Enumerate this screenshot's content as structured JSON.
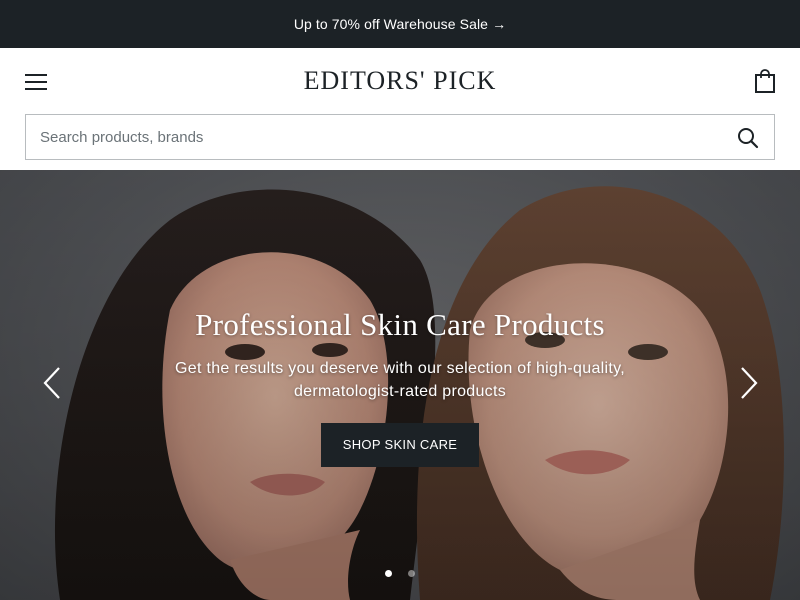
{
  "announcement": {
    "text": "Up to 70% off Warehouse Sale",
    "arrow": "→"
  },
  "header": {
    "logo": "EDITORS' PICK",
    "menu_icon": "hamburger-menu-icon",
    "cart_icon": "shopping-bag-icon"
  },
  "search": {
    "placeholder": "Search products, brands",
    "value": "",
    "icon": "search-icon"
  },
  "hero": {
    "title": "Professional Skin Care Products",
    "subtitle": "Get the results you deserve with our selection of high-quality, dermatologist-rated products",
    "cta_label": "SHOP SKIN CARE",
    "prev_icon": "chevron-left-icon",
    "next_icon": "chevron-right-icon",
    "slides": [
      {
        "active": true
      },
      {
        "active": false
      }
    ]
  },
  "colors": {
    "dark": "#1c2226",
    "white": "#ffffff",
    "border": "#b8bcbf",
    "hero_bg": "#55575b"
  }
}
